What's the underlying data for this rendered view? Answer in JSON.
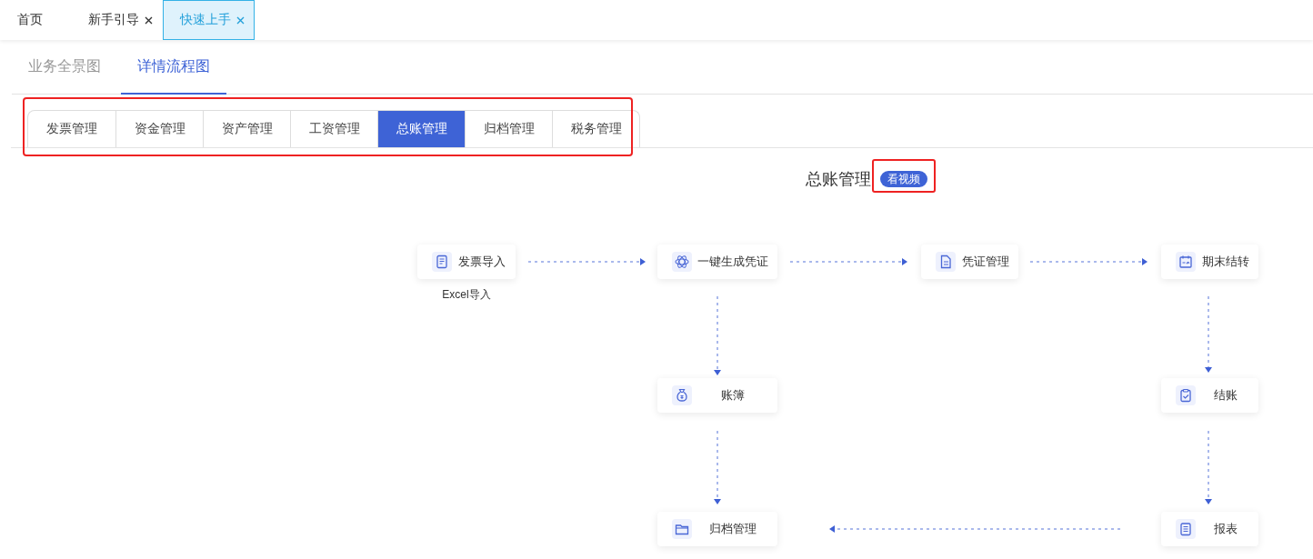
{
  "top_tabs": [
    {
      "label": "首页",
      "closable": false,
      "selected": false
    },
    {
      "label": "新手引导",
      "closable": true,
      "selected": false
    },
    {
      "label": "快速上手",
      "closable": true,
      "selected": true
    }
  ],
  "view_tabs": [
    {
      "label": "业务全景图",
      "selected": false
    },
    {
      "label": "详情流程图",
      "selected": true
    }
  ],
  "module_tabs": {
    "highlighted": true,
    "items": [
      {
        "label": "发票管理",
        "selected": false
      },
      {
        "label": "资金管理",
        "selected": false
      },
      {
        "label": "资产管理",
        "selected": false
      },
      {
        "label": "工资管理",
        "selected": false
      },
      {
        "label": "总账管理",
        "selected": true
      },
      {
        "label": "归档管理",
        "selected": false
      },
      {
        "label": "税务管理",
        "selected": false
      }
    ]
  },
  "flow": {
    "title": "总账管理",
    "video_button": {
      "label": "看视频",
      "highlighted": true
    },
    "nodes": [
      {
        "label": "发票导入",
        "note": "Excel导入"
      },
      {
        "label": "一键生成凭证"
      },
      {
        "label": "凭证管理"
      },
      {
        "label": "期末结转"
      },
      {
        "label": "账簿"
      },
      {
        "label": "结账"
      },
      {
        "label": "归档管理"
      },
      {
        "label": "报表"
      }
    ]
  }
}
